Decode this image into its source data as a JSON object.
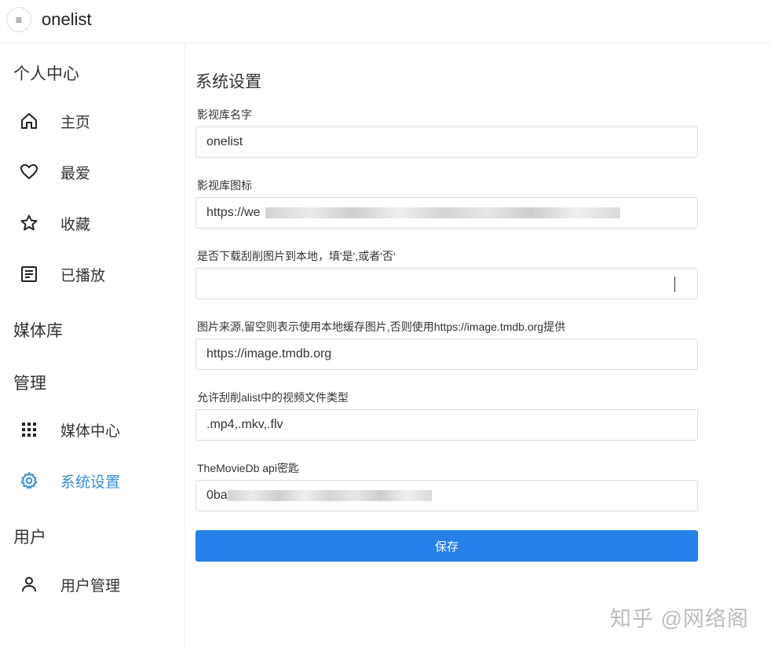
{
  "header": {
    "title": "onelist",
    "menu_icon": "≡"
  },
  "sidebar": {
    "section_personal": "个人中心",
    "items_personal": [
      {
        "label": "主页",
        "icon": "home-icon"
      },
      {
        "label": "最爱",
        "icon": "heart-icon"
      },
      {
        "label": "收藏",
        "icon": "star-icon"
      },
      {
        "label": "已播放",
        "icon": "history-icon"
      }
    ],
    "section_media": "媒体库",
    "section_manage": "管理",
    "items_manage": [
      {
        "label": "媒体中心",
        "icon": "grid-icon"
      },
      {
        "label": "系统设置",
        "icon": "gear-icon",
        "active": true
      }
    ],
    "section_user": "用户",
    "items_user": [
      {
        "label": "用户管理",
        "icon": "person-icon"
      }
    ]
  },
  "settings": {
    "title": "系统设置",
    "fields": [
      {
        "label": "影视库名字",
        "value": "onelist"
      },
      {
        "label": "影视库图标",
        "value": "https://we"
      },
      {
        "label": "是否下载刮削图片到本地，填'是',或者'否'",
        "value": ""
      },
      {
        "label": "图片来源,留空则表示使用本地缓存图片,否则使用https://image.tmdb.org提供",
        "value": "https://image.tmdb.org"
      },
      {
        "label": "允许刮削alist中的视频文件类型",
        "value": ".mp4,.mkv,.flv"
      },
      {
        "label": "TheMovieDb api密匙",
        "value": "0ba"
      }
    ],
    "save_label": "保存"
  },
  "watermark": "知乎 @网络阁",
  "colors": {
    "accent": "#2580e8",
    "active_nav": "#3a8fd6"
  }
}
